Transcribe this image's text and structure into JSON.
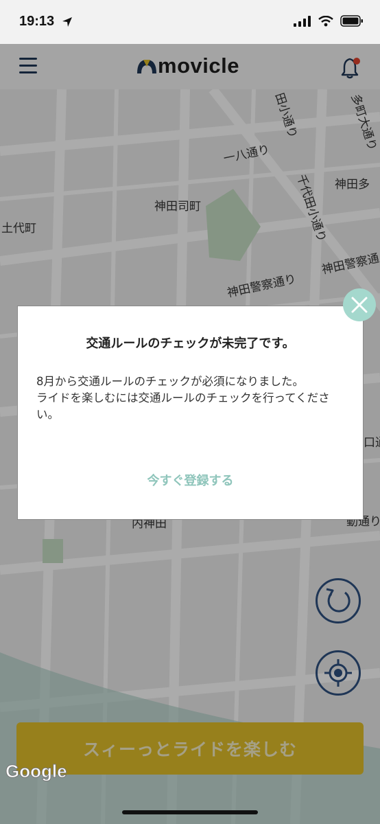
{
  "status_bar": {
    "time": "19:13"
  },
  "header": {
    "brand": "movicle"
  },
  "map": {
    "labels": {
      "l1": "神田司町",
      "l2": "土代町",
      "l3": "神田多",
      "l4": "一八通り",
      "l5": "千代田小通り",
      "l6": "神田警察通り",
      "l7": "神田警察通",
      "l8": "多町大通り",
      "l9": "田小通り",
      "l10": "内神田",
      "l11": "口通",
      "l12": "動通り"
    }
  },
  "dialog": {
    "title": "交通ルールのチェックが未完了です。",
    "message_line1": "8月から交通ルールのチェックが必須になりました。",
    "message_line2": "ライドを楽しむには交通ルールのチェックを行ってください。",
    "cta_label": "今すぐ登録する"
  },
  "ride_button": {
    "label": "スィーっとライドを楽しむ"
  },
  "map_attribution": {
    "text": "Google"
  },
  "colors": {
    "accent_mint": "#a4d8cd",
    "navy": "#1f3656",
    "ride_yellow": "#e2bf2a",
    "notification_dot": "#e0442f"
  }
}
